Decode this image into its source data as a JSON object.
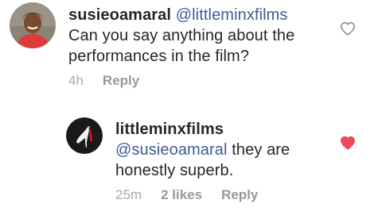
{
  "comment": {
    "username": "susieoamaral",
    "mention": "@littleminxfilms",
    "text_line1": "Can you say anything about the",
    "text_line2": "performances in the film?",
    "time": "4h",
    "reply_label": "Reply",
    "liked": false
  },
  "reply": {
    "username": "littleminxfilms",
    "mention": "@susieoamaral",
    "text_line1": " they are",
    "text_line2": "honestly superb.",
    "time": "25m",
    "likes_label": "2 likes",
    "reply_label": "Reply",
    "liked": true
  },
  "colors": {
    "text": "#262626",
    "meta": "#999999",
    "mention": "#3e5a96",
    "liked_heart": "#ed4956",
    "unliked_heart": "#8e8e8e"
  },
  "icons": {
    "avatar1": "user-photo",
    "avatar2": "red-sole-shoe-logo",
    "heart": "heart-icon"
  }
}
